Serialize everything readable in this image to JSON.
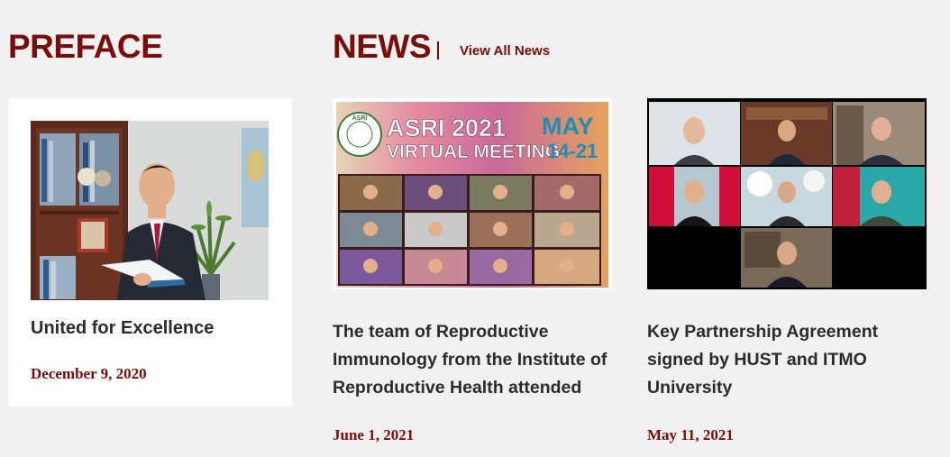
{
  "preface": {
    "heading": "PREFACE",
    "card": {
      "title": "United for Excellence",
      "date": "December 9, 2020"
    }
  },
  "news": {
    "heading": "NEWS",
    "view_all_label": "View All News",
    "items": [
      {
        "title": "The team of Reproductive Immunology from the Institute of Reproductive Health attended",
        "date": "June 1, 2021",
        "image": {
          "org": "ASRI",
          "headline": "ASRI 2021",
          "subheadline": "VIRTUAL MEETING",
          "month": "MAY",
          "days": "14-21"
        }
      },
      {
        "title": "Key Partnership Agreement signed by HUST and ITMO University",
        "date": "May 11, 2021"
      }
    ]
  },
  "colors": {
    "accent": "#7b0c0c",
    "text": "#2b2b2b",
    "background": "#f1f1f1",
    "card": "#ffffff"
  }
}
